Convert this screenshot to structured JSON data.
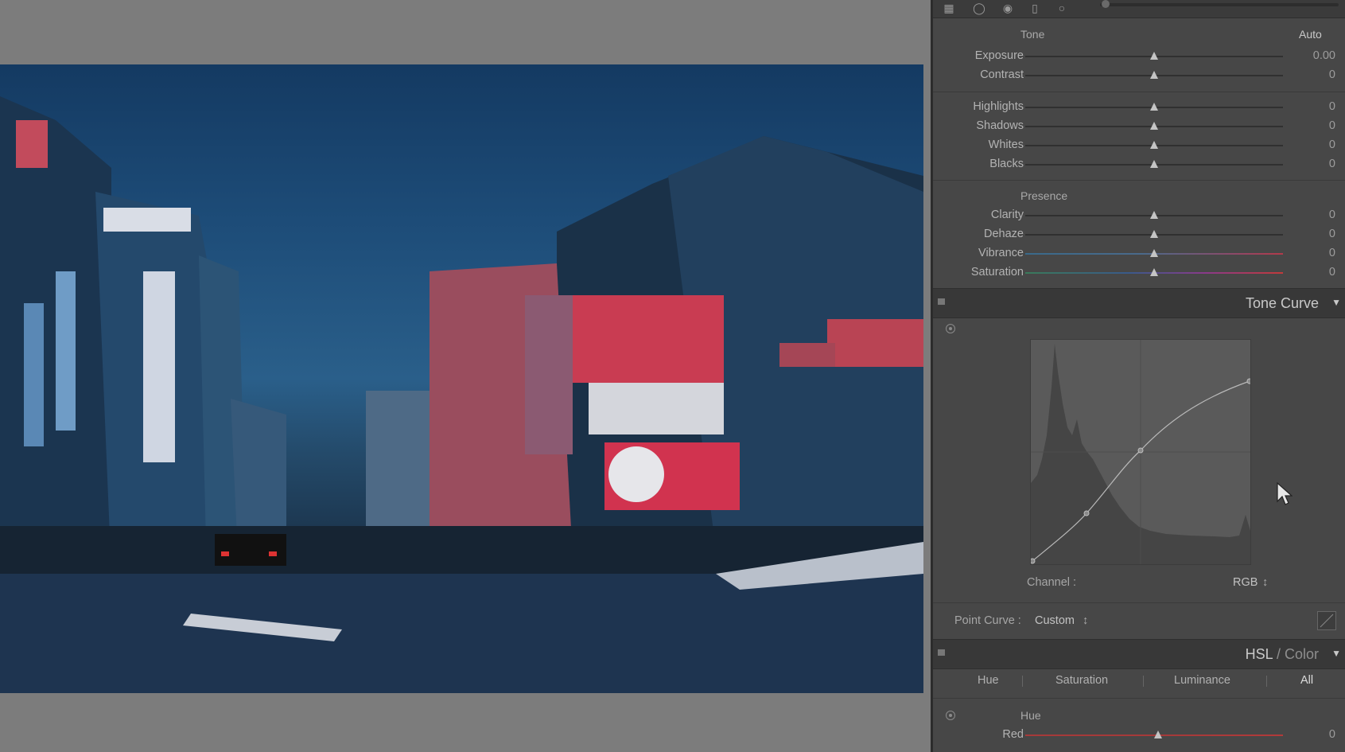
{
  "tone": {
    "section": "Tone",
    "auto": "Auto",
    "sliders": [
      {
        "label": "Exposure",
        "value": "0.00"
      },
      {
        "label": "Contrast",
        "value": "0"
      },
      {
        "label": "Highlights",
        "value": "0"
      },
      {
        "label": "Shadows",
        "value": "0"
      },
      {
        "label": "Whites",
        "value": "0"
      },
      {
        "label": "Blacks",
        "value": "0"
      }
    ]
  },
  "presence": {
    "section": "Presence",
    "sliders": [
      {
        "label": "Clarity",
        "value": "0"
      },
      {
        "label": "Dehaze",
        "value": "0"
      },
      {
        "label": "Vibrance",
        "value": "0"
      },
      {
        "label": "Saturation",
        "value": "0"
      }
    ]
  },
  "tone_curve": {
    "title": "Tone Curve",
    "channel_label": "Channel :",
    "channel_value": "RGB",
    "channel_caret": "↕",
    "point_curve_label": "Point Curve :",
    "point_curve_value": "Custom",
    "point_curve_caret": "↕"
  },
  "hsl": {
    "title_hsl": "HSL",
    "title_sep": " / ",
    "title_color": "Color",
    "tabs": [
      "Hue",
      "Saturation",
      "Luminance",
      "All"
    ],
    "section": "Hue",
    "sliders": [
      {
        "label": "Red",
        "value": "0"
      }
    ]
  },
  "colors": {
    "panel_bg": "#474747",
    "header_bg": "#383838"
  },
  "icons": [
    "grid-icon",
    "crop-icon",
    "spot-removal-icon",
    "redeye-icon",
    "graduated-filter-icon",
    "radial-filter-icon",
    "targeted-adjustment-icon",
    "pointer-cursor-icon"
  ]
}
